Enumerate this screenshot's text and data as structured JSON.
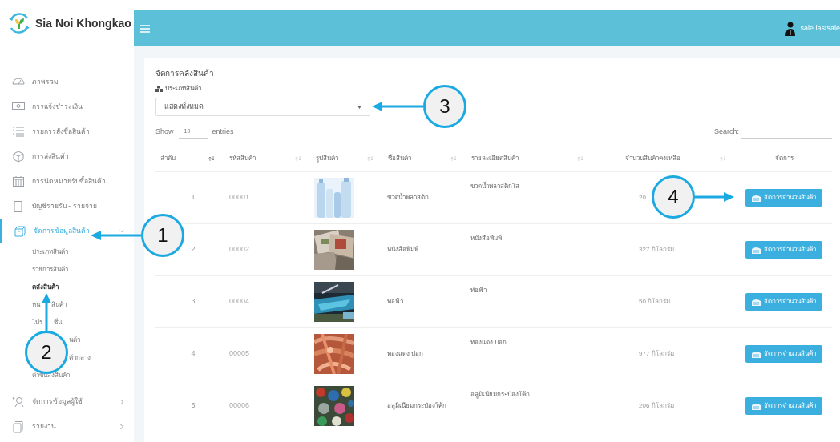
{
  "brand": {
    "name": "Sia Noi Khongkao"
  },
  "header": {
    "user": "sale lastsale"
  },
  "sidebar": {
    "items": [
      {
        "label": "ภาพรวม",
        "selected": false
      },
      {
        "label": "การแจ้งชำระเงิน",
        "selected": false
      },
      {
        "label": "รายการสั่งซื้อสินค้า",
        "selected": false
      },
      {
        "label": "การส่งสินค้า",
        "selected": false
      },
      {
        "label": "การนัดหมายรับซื้อสินค้า",
        "selected": false
      },
      {
        "label": "บัญชีรายรับ - รายจ่าย",
        "selected": false
      },
      {
        "label": "จัดการข้อมูลสินค้า",
        "selected": true,
        "expanded": true,
        "children": [
          {
            "label": "ประเภทสินค้า",
            "selected": false,
            "kind": "link"
          },
          {
            "label": "รายการสินค้า",
            "selected": false,
            "kind": "link"
          },
          {
            "label": "คลังสินค้า",
            "selected": true,
            "kind": "link"
          },
          {
            "label": "หน",
            "label_end": "สินค้า",
            "selected": false,
            "kind": "split"
          },
          {
            "label": "โปร",
            "label_end": "ชั่น",
            "selected": false,
            "kind": "split"
          },
          {
            "label": "นค้า",
            "selected": false,
            "kind": "covered"
          },
          {
            "label": "ค้ากลาง",
            "selected": false,
            "kind": "covered"
          },
          {
            "label": "ค่าขนส่งสินค้า",
            "selected": false,
            "kind": "link"
          }
        ]
      },
      {
        "label": "จัดการข้อมูลผู้ใช้",
        "selected": false,
        "expanded": false
      },
      {
        "label": "รายงาน",
        "selected": false,
        "expanded": false
      }
    ]
  },
  "page": {
    "title": "จัดการคลังสินค้า",
    "filter_label": "ประเภทสินค้า",
    "filter_value": "แสดงทั้งหมด",
    "show_label": "Show",
    "page_size": "10",
    "entries_label": "entries",
    "search_label": "Search:"
  },
  "table": {
    "columns": [
      "ลำดับ",
      "รหัสสินค้า",
      "รูปสินค้า",
      "ชื่อสินค้า",
      "รายละเอียดสินค้า",
      "จำนวนสินค้าคงเหลือ",
      "จัดการ"
    ],
    "rows": [
      {
        "no": "1",
        "code": "00001",
        "name": "ขวดน้ำพลาสติก",
        "detail": "ขวดน้ำพลาสติกใส",
        "stock": "20",
        "action": "จัดการจำนวนสินค้า"
      },
      {
        "no": "2",
        "code": "00002",
        "name": "หนังสือพิมพ์",
        "detail": "หนังสือพิมพ์",
        "stock": "327 กิโลกรัม",
        "action": "จัดการจำนวนสินค้า"
      },
      {
        "no": "3",
        "code": "00004",
        "name": "ท่อฟ้า",
        "detail": "ท่อฟ้า",
        "stock": "50 กิโลกรัม",
        "action": "จัดการจำนวนสินค้า"
      },
      {
        "no": "4",
        "code": "00005",
        "name": "ทองแดง ปอก",
        "detail": "ทองแดง ปอก",
        "stock": "977 กิโลกรัม",
        "action": "จัดการจำนวนสินค้า"
      },
      {
        "no": "5",
        "code": "00006",
        "name": "อลูมิเนียมกระป๋องโค้ก",
        "detail": "อลูมิเนียมกระป๋องโค้ก",
        "stock": "206 กิโลกรัม",
        "action": "จัดการจำนวนสินค้า"
      }
    ]
  },
  "callouts": [
    {
      "label": "1"
    },
    {
      "label": "2"
    },
    {
      "label": "3"
    },
    {
      "label": "4"
    }
  ]
}
